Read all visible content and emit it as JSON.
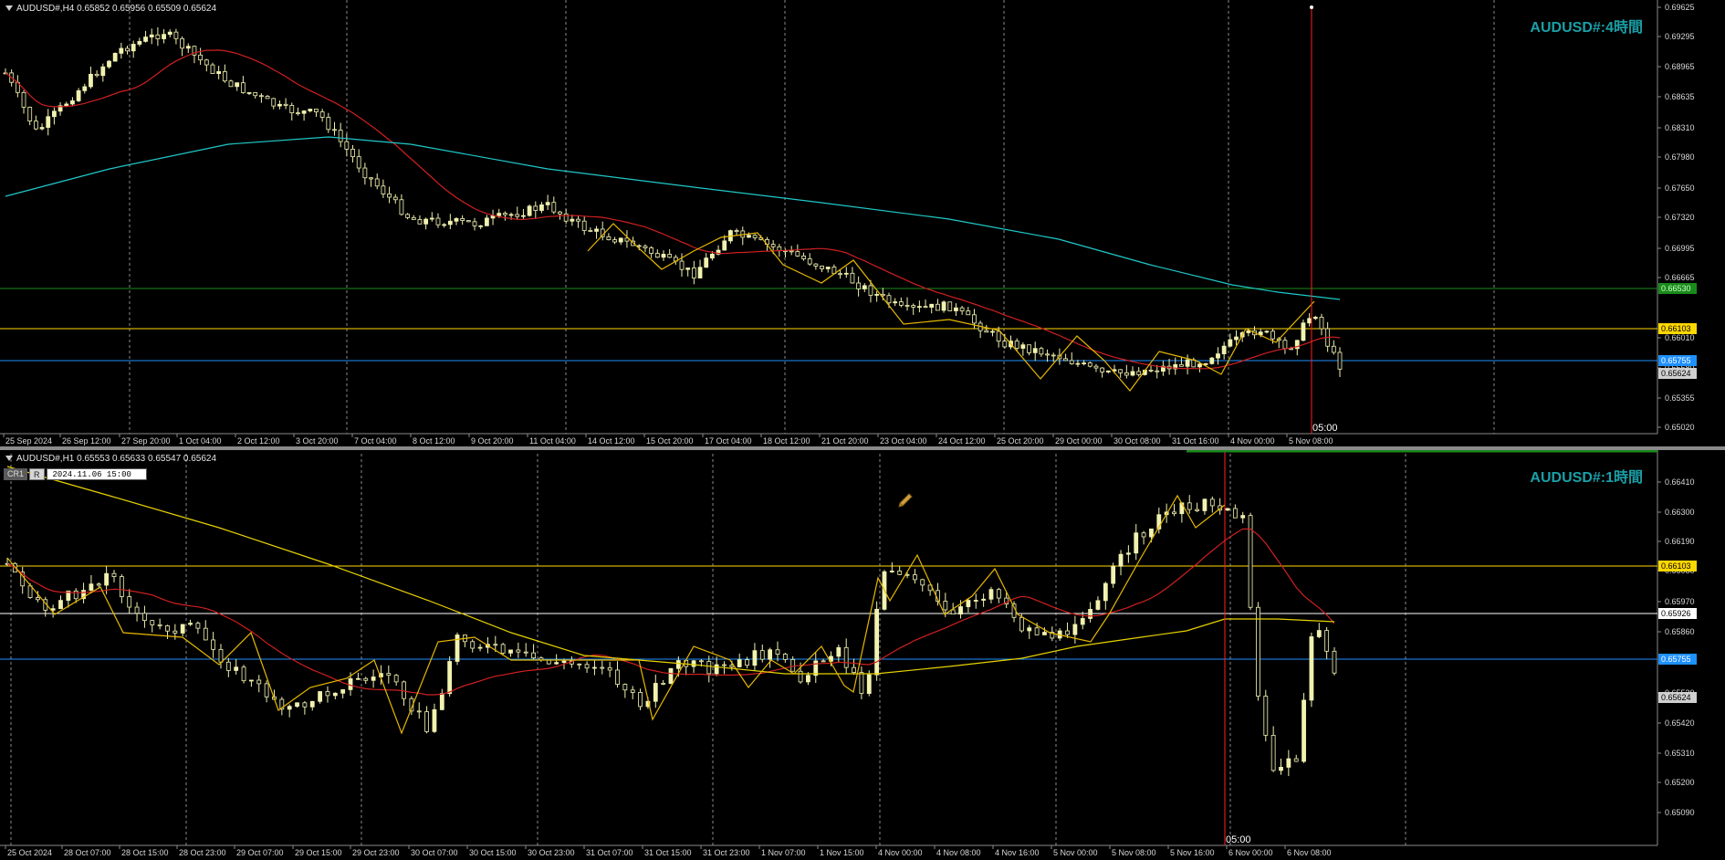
{
  "top_chart": {
    "header": "AUDUSD#,H4  0.65852 0.65956 0.65509 0.65624",
    "title": "AUDUSD#:4時間",
    "price_labels": [
      "0.69625",
      "0.69295",
      "0.68965",
      "0.68635",
      "0.68310",
      "0.67980",
      "0.67650",
      "0.67320",
      "0.66995",
      "0.66665",
      "0.66010",
      "0.65680",
      "0.65355",
      "0.65020"
    ],
    "time_labels": [
      "25 Sep 2024",
      "26 Sep 12:00",
      "27 Sep 20:00",
      "1 Oct 04:00",
      "2 Oct 12:00",
      "3 Oct 20:00",
      "7 Oct 04:00",
      "8 Oct 12:00",
      "9 Oct 20:00",
      "11 Oct 04:00",
      "14 Oct 12:00",
      "15 Oct 20:00",
      "17 Oct 04:00",
      "18 Oct 12:00",
      "21 Oct 20:00",
      "23 Oct 04:00",
      "24 Oct 12:00",
      "25 Oct 20:00",
      "29 Oct 00:00",
      "30 Oct 08:00",
      "31 Oct 16:00",
      "4 Nov 00:00",
      "5 Nov 08:00"
    ],
    "level_tags": [
      {
        "text": "0.66530",
        "bg": "#1a8a1a",
        "fg": "#c8ffc8"
      },
      {
        "text": "0.66103",
        "bg": "#ffd700",
        "fg": "#000000"
      },
      {
        "text": "0.65755",
        "bg": "#1e90ff",
        "fg": "#ffffff"
      },
      {
        "text": "0.65624",
        "bg": "#d0d0d0",
        "fg": "#000000"
      }
    ],
    "cursor_time": "05:00"
  },
  "bottom_chart": {
    "header": "AUDUSD#,H1  0.65553 0.65633 0.65547 0.65624",
    "title": "AUDUSD#:1時間",
    "cr1": "CR1",
    "r": "R",
    "crosshair_date": "2024.11.06 15:00",
    "price_labels": [
      "0.66410",
      "0.66300",
      "0.66190",
      "0.66080",
      "0.65970",
      "0.65860",
      "0.65530",
      "0.65420",
      "0.65310",
      "0.65200",
      "0.65090"
    ],
    "time_labels": [
      "25 Oct 2024",
      "28 Oct 07:00",
      "28 Oct 15:00",
      "28 Oct 23:00",
      "29 Oct 07:00",
      "29 Oct 15:00",
      "29 Oct 23:00",
      "30 Oct 07:00",
      "30 Oct 15:00",
      "30 Oct 23:00",
      "31 Oct 07:00",
      "31 Oct 15:00",
      "31 Oct 23:00",
      "1 Nov 07:00",
      "1 Nov 15:00",
      "4 Nov 00:00",
      "4 Nov 08:00",
      "4 Nov 16:00",
      "5 Nov 00:00",
      "5 Nov 08:00",
      "5 Nov 16:00",
      "6 Nov 00:00",
      "6 Nov 08:00"
    ],
    "level_tags": [
      {
        "text": "0.66103",
        "bg": "#ffd700",
        "fg": "#000000"
      },
      {
        "text": "0.65926",
        "bg": "#ffffff",
        "fg": "#000000"
      },
      {
        "text": "0.65755",
        "bg": "#1e90ff",
        "fg": "#ffffff"
      },
      {
        "text": "0.65624",
        "bg": "#d0d0d0",
        "fg": "#000000"
      }
    ],
    "cursor_time": "05:00"
  },
  "colors": {
    "candle": "#f2f2b0",
    "ma_short": "#d02020",
    "ma_long_top": "#20c8c8",
    "ma_long_bottom": "#e6d200",
    "zigzag": "#e6b800",
    "cursor": "#ff2020",
    "grid": "#8a8a8a",
    "title": "#1aa0a8"
  }
}
